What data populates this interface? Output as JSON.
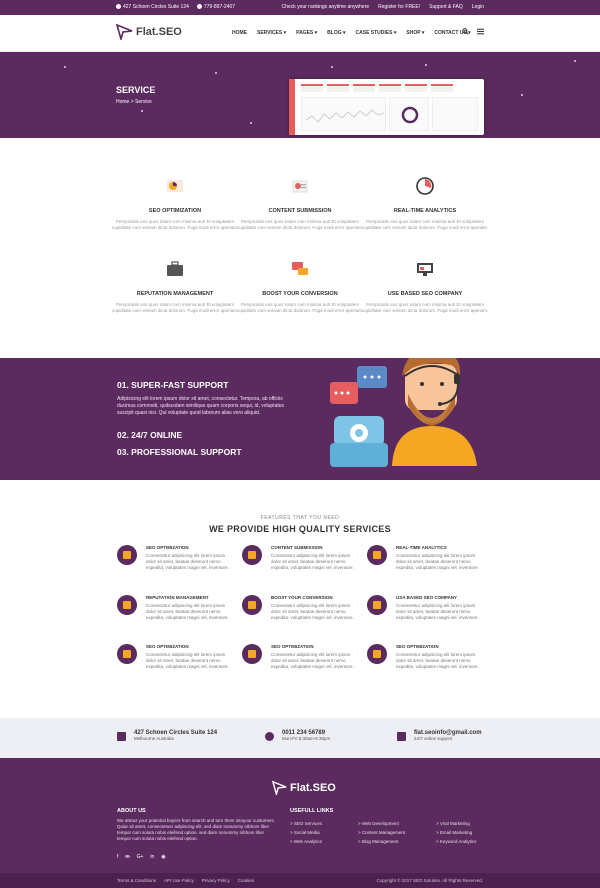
{
  "topbar": {
    "address": "427 Schoen Circles Suite 124",
    "phone": "779-897-2407",
    "links": [
      "Check your rankings anytime anywhere",
      "Register for FREE!",
      "Support & FAQ",
      "Login"
    ]
  },
  "brand": {
    "name": "Flat.SEO"
  },
  "nav": {
    "items": [
      "HOME",
      "SERVICES",
      "PAGES",
      "BLOG",
      "CASE STUDIES",
      "SHOP",
      "CONTACT US"
    ],
    "icons": [
      "search-icon",
      "menu-icon"
    ]
  },
  "hero": {
    "title": "SERVICE",
    "breadcrumb": {
      "home": "Home",
      "separator": ">",
      "current": "Service"
    }
  },
  "services": [
    {
      "title": "SEO OPTIMIZATION",
      "text": "Perspiciatis eos quos totam cum minima aut! Et voluptatem cupiditate cum veniam dicta dolorum. Fuga modi error aperiam.",
      "icon": "seo-chart-icon"
    },
    {
      "title": "CONTENT SUBMISSION",
      "text": "Perspiciatis eos quos totam cum minima aut! Et voluptatem cupiditate cum veniam dicta dolorum. Fuga modi error aperiam.",
      "icon": "content-icon"
    },
    {
      "title": "REAL-TIME ANALYTICS",
      "text": "Perspiciatis eos quos totam cum minima aut! Et voluptatem cupiditate cum veniam dicta dolorum. Fuga modi error aperiam.",
      "icon": "analytics-icon"
    },
    {
      "title": "REPUTATION MANAGEMENT",
      "text": "Perspiciatis eos quos totam cum minima aut! Et voluptatem cupiditate cum veniam dicta dolorum. Fuga modi error aperiam.",
      "icon": "briefcase-icon"
    },
    {
      "title": "BOOST YOUR CONVERSION",
      "text": "Perspiciatis eos quos totam cum minima aut! Et voluptatem cupiditate cum veniam dicta dolorum. Fuga modi error aperiam.",
      "icon": "chat-icon"
    },
    {
      "title": "USE BASED SEO COMPANY",
      "text": "Perspiciatis eos quos totam cum minima aut! Et voluptatem cupiditate cum veniam dicta dolorum. Fuga modi error aperiam.",
      "icon": "monitor-icon"
    }
  ],
  "support": {
    "item1": "01. SUPER-FAST SUPPORT",
    "item1_text": "Adipisicing elit lorem ipsum dolor sit amet, consectetur. Tempora, ab officiis ducimus commodi, quibusdam similique quam corporis sequi, id, voluptates suscipit quasi nisi. Qui voluptate quod laborum alias vero aliquid.",
    "item2": "02. 24/7 ONLINE",
    "item3": "03. PROFESSIONAL SUPPORT"
  },
  "features": {
    "eyebrow": "FEATURES THAT YOU NEED",
    "headline": "WE PROVIDE HIGH QUALITY SERVICES",
    "items": [
      {
        "title": "SEO OPTIMIZATION",
        "text": "Consectetur adipisicing elit lorem ipsum dolor sit amet, beatae deserunt nemo expedita, voluptates magni vel, inventore."
      },
      {
        "title": "CONTENT SUBMISSION",
        "text": "Consectetur adipisicing elit lorem ipsum dolor sit amet, beatae deserunt nemo expedita, voluptates magni vel, inventore."
      },
      {
        "title": "REAL-TIME ANALYTICS",
        "text": "Consectetur adipisicing elit lorem ipsum dolor sit amet, beatae deserunt nemo expedita, voluptates magni vel, inventore."
      },
      {
        "title": "REPUTATION MANAGEMENT",
        "text": "Consectetur adipisicing elit lorem ipsum dolor sit amet, beatae deserunt nemo expedita, voluptates magni vel, inventore."
      },
      {
        "title": "BOOST YOUR CONVERSION",
        "text": "Consectetur adipisicing elit lorem ipsum dolor sit amet, beatae deserunt nemo expedita, voluptates magni vel, inventore."
      },
      {
        "title": "USA BASED SEO COMPANY",
        "text": "Consectetur adipisicing elit lorem ipsum dolor sit amet, beatae deserunt nemo expedita, voluptates magni vel, inventore."
      },
      {
        "title": "SEO OPTIMIZATION",
        "text": "Consectetur adipisicing elit lorem ipsum dolor sit amet, beatae deserunt nemo expedita, voluptates magni vel, inventore."
      },
      {
        "title": "SEO OPTIMIZATION",
        "text": "Consectetur adipisicing elit lorem ipsum dolor sit amet, beatae deserunt nemo expedita, voluptates magni vel, inventore."
      },
      {
        "title": "SEO OPTIMIZATION",
        "text": "Consectetur adipisicing elit lorem ipsum dolor sit amet, beatae deserunt nemo expedita, voluptates magni vel, inventore."
      }
    ]
  },
  "contact": {
    "address": "427 Schoen Circles Suite 124",
    "city": "Melbourne Australia",
    "phone": "0011 234 56789",
    "hours": "Mon-Fri 8:30am-6:30pm",
    "email": "flat.seoinfo@gmail.com",
    "email_sub": "24/7 online support"
  },
  "footer": {
    "about_title": "ABOUT US",
    "about_text": "We attract your potential buyers from search and turn them intoyour customers. Quiar sit amet, consectetuer adipiscing elit, sed diam nonummy nibhom liber tempor cum soluta nobis eleifend option. sed diam nonummy nibhom liber tempor cum soluta nobis eleifend option.",
    "social": [
      "f",
      "ᵯ",
      "G+",
      "in",
      "◉"
    ],
    "links_title": "USEFULL LINKS",
    "links_col1": [
      "> SEO Services",
      "> Social Media",
      "> Web Analytics"
    ],
    "links_col2": [
      "> Web Development",
      "> Content Management",
      "> Blog Management"
    ],
    "links_col3": [
      "> Viral Marketing",
      "> Email Marketing",
      "> Keyword Analytics"
    ]
  },
  "bottom": {
    "links": [
      "Terms & Conditions",
      "API Use Policy",
      "Privacy Policy",
      "Cookies"
    ],
    "copyright": "Copyright © 2017 SEO Solution. All Rights Reserved."
  },
  "colors": {
    "primary": "#5b2a5e",
    "accent": "#f5a623",
    "red": "#e85d5d"
  }
}
